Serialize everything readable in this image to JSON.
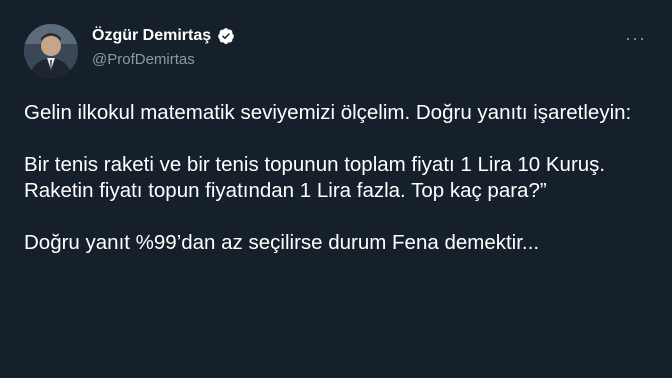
{
  "tweet": {
    "author": {
      "display_name": "Özgür Demirtaş",
      "handle": "@ProfDemirtas",
      "avatar_icon": "profile-photo",
      "verified_icon": "verified-badge-icon"
    },
    "more_label": "···",
    "paragraphs": [
      "Gelin ilkokul matematik seviyemizi ölçelim. Doğru yanıtı işaretleyin:",
      "Bir tenis raketi ve bir tenis topunun toplam fiyatı 1 Lira 10 Kuruş. Raketin fiyatı topun fiyatından 1 Lira fazla. Top kaç para?”",
      "Doğru yanıt %99’dan az seçilirse durum Fena demektir..."
    ]
  },
  "colors": {
    "background": "#15202b",
    "text": "#ffffff",
    "secondary_text": "#8b98a5",
    "verified": "#ffffff"
  }
}
